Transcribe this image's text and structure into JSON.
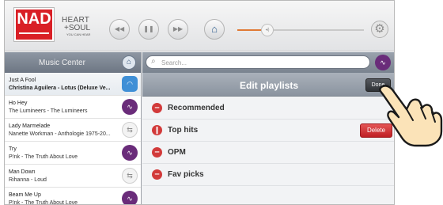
{
  "brand": {
    "logo_text": "NAD",
    "tagline_line1": "HEART",
    "tagline_line2": "+SOUL",
    "tagline_line3": "YOU CAN HEAR"
  },
  "player": {
    "prev_icon": "previous-icon",
    "play_pause_icon": "play-pause-icon",
    "next_icon": "next-icon",
    "home_icon": "home-icon",
    "volume_icon": "speaker-icon",
    "settings_icon": "gear-icon",
    "volume_level_fraction": 0.2
  },
  "music_center": {
    "title": "Music Center",
    "tracks": [
      {
        "title": "Just A Fool",
        "subtitle": "Christina Aguilera - Lotus (Deluxe Ve...",
        "source": "cloud"
      },
      {
        "title": "Ho Hey",
        "subtitle": "The Lumineers - The Lumineers",
        "source": "purple"
      },
      {
        "title": "Lady Marmelade",
        "subtitle": "Nanette Workman - Anthologie 1975-20...",
        "source": "usb"
      },
      {
        "title": "Try",
        "subtitle": "P!nk - The Truth About Love",
        "source": "purple"
      },
      {
        "title": "Man Down",
        "subtitle": "Rihanna - Loud",
        "source": "usb"
      },
      {
        "title": "Beam Me Up",
        "subtitle": "P!nk - The Truth About Love",
        "source": "purple"
      }
    ]
  },
  "search": {
    "placeholder": "Search..."
  },
  "edit_playlists": {
    "title": "Edit playlists",
    "done_label": "Done",
    "delete_label": "Delete",
    "playlists": [
      {
        "name": "Recommended"
      },
      {
        "name": "Top hits"
      },
      {
        "name": "OPM"
      },
      {
        "name": "Fav picks"
      }
    ]
  },
  "colors": {
    "brand_red": "#d91f26",
    "delete_red": "#c9262b",
    "source_purple": "#6a2c7a",
    "source_cloud": "#3f8fd6",
    "volume_orange": "#e07a35"
  }
}
